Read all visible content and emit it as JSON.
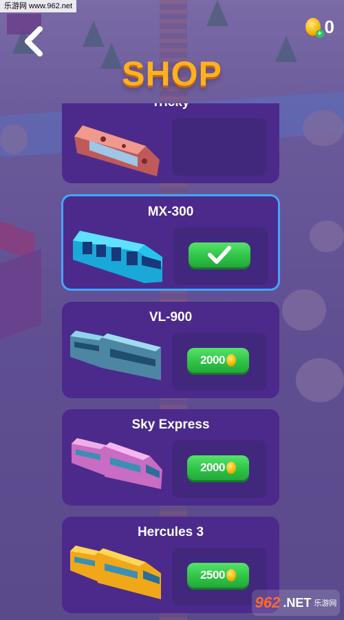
{
  "watermark": {
    "top_text": "乐游网 www.962.net",
    "bottom_logo": "962",
    "bottom_net": ".NET",
    "bottom_cn": "乐游网"
  },
  "header": {
    "title": "SHOP",
    "coins": "0",
    "back_icon": "chevron-left-icon",
    "coin_icon": "coin-plus-icon"
  },
  "colors": {
    "title": "#ffb11f",
    "card": "#4b2a8c",
    "selected_border": "#41a7ff",
    "button": "#2fc446",
    "background": "#5b4a8f"
  },
  "trains": [
    {
      "name": "Tricky",
      "state": "locked",
      "price": "",
      "color": "#e07a7a"
    },
    {
      "name": "MX-300",
      "state": "selected",
      "price": "",
      "color": "#27c3f0"
    },
    {
      "name": "VL-900",
      "state": "buy",
      "price": "2000",
      "color": "#5fa9c4"
    },
    {
      "name": "Sky Express",
      "state": "buy",
      "price": "2000",
      "color": "#e28ad8"
    },
    {
      "name": "Hercules 3",
      "state": "buy",
      "price": "2500",
      "color": "#ffbe1f"
    }
  ]
}
